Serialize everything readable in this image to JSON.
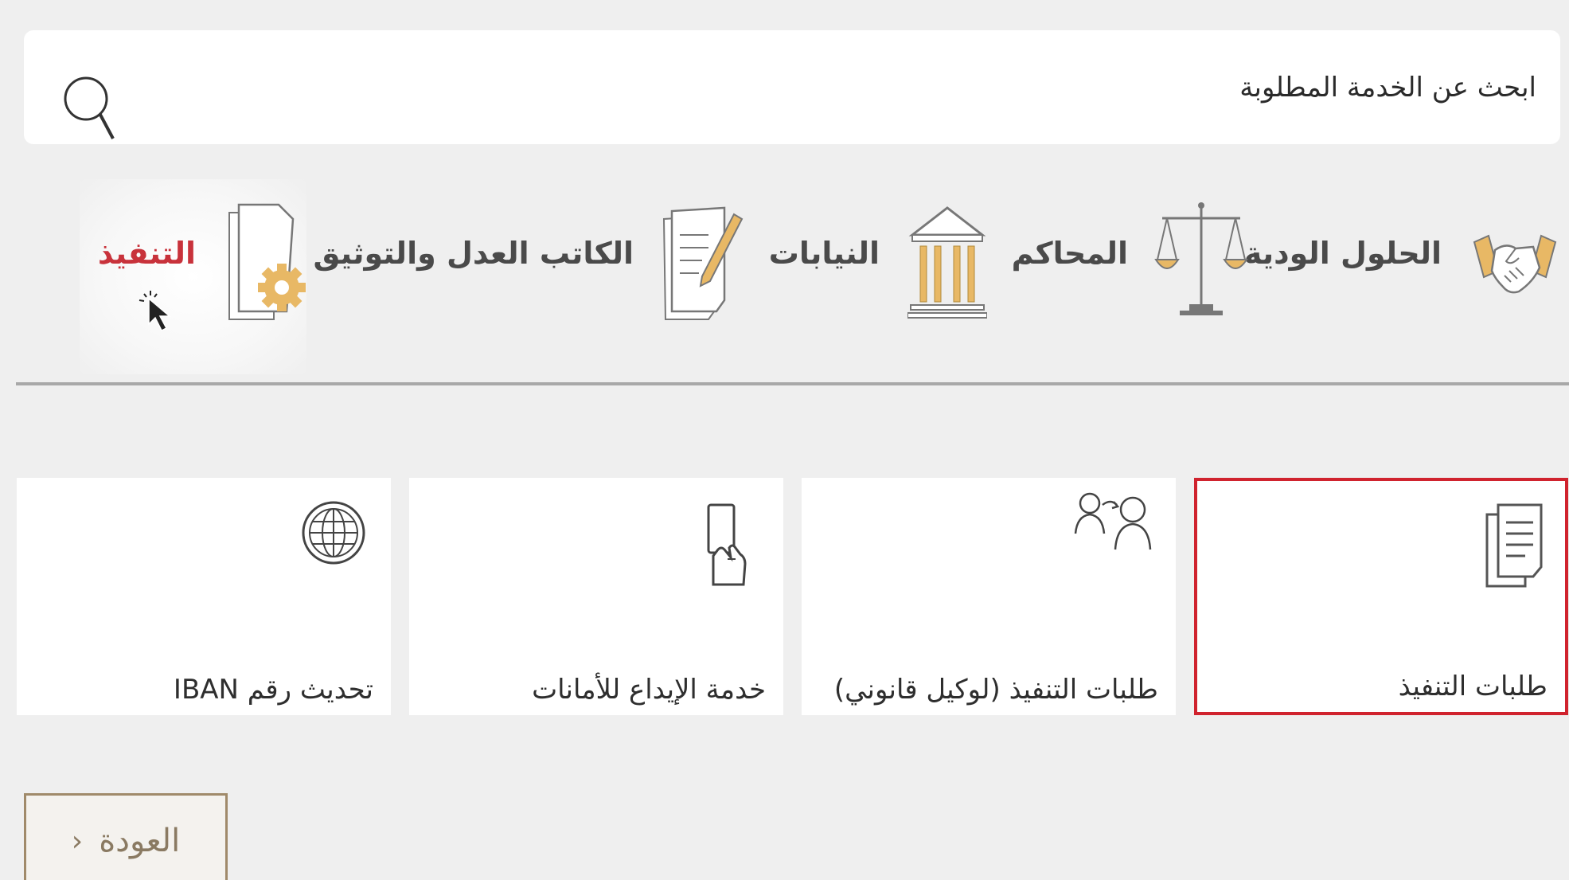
{
  "search": {
    "placeholder": "ابحث عن الخدمة المطلوبة"
  },
  "categories": [
    {
      "label": "الحلول الودية",
      "icon": "handshake-icon",
      "active": false
    },
    {
      "label": "المحاكم",
      "icon": "scales-icon",
      "active": false
    },
    {
      "label": "النيابات",
      "icon": "courthouse-icon",
      "active": false
    },
    {
      "label": "الكاتب العدل والتوثيق",
      "icon": "document-pen-icon",
      "active": false
    },
    {
      "label": "التنفيذ",
      "icon": "document-gear-icon",
      "active": true
    }
  ],
  "cards": [
    {
      "label": "طلبات التنفيذ",
      "icon": "documents-icon",
      "selected": true
    },
    {
      "label": "طلبات التنفيذ (لوكيل قانوني)",
      "icon": "user-transfer-icon",
      "selected": false
    },
    {
      "label": "خدمة الإيداع للأمانات",
      "icon": "hand-card-icon",
      "selected": false
    },
    {
      "label": "تحديث رقم IBAN",
      "icon": "globe-icon",
      "selected": false
    }
  ],
  "back_button": {
    "label": "العودة",
    "chevron": "‹"
  },
  "colors": {
    "background": "#efefef",
    "active_category": "#c8323b",
    "selected_card_border": "#d0232e",
    "icon_gold": "#e8b865",
    "back_button_border": "#a08a6a"
  }
}
